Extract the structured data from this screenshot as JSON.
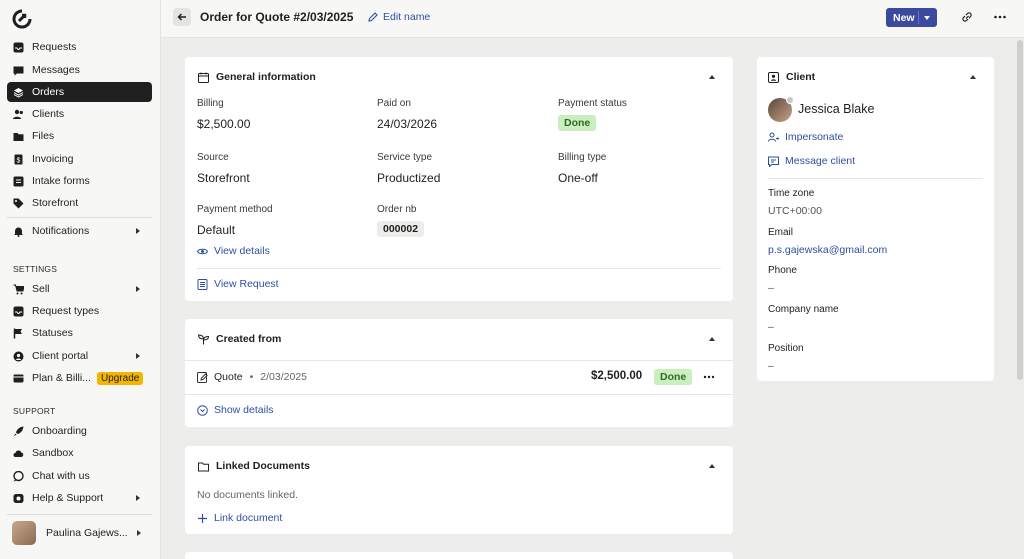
{
  "sidebar": {
    "nav": [
      {
        "label": "Requests",
        "icon": "inbox-icon"
      },
      {
        "label": "Messages",
        "icon": "chat-icon"
      },
      {
        "label": "Orders",
        "icon": "layers-icon",
        "active": true
      },
      {
        "label": "Clients",
        "icon": "users-icon"
      },
      {
        "label": "Files",
        "icon": "folder-icon"
      },
      {
        "label": "Invoicing",
        "icon": "invoice-icon"
      },
      {
        "label": "Intake forms",
        "icon": "form-icon"
      },
      {
        "label": "Storefront",
        "icon": "tag-icon"
      }
    ],
    "notifications": "Notifications",
    "settings_title": "SETTINGS",
    "settings": [
      {
        "label": "Sell",
        "icon": "cart-icon",
        "has_submenu": true
      },
      {
        "label": "Request types",
        "icon": "inbox-icon"
      },
      {
        "label": "Statuses",
        "icon": "flag-icon"
      },
      {
        "label": "Client portal",
        "icon": "globe-icon",
        "has_submenu": true
      },
      {
        "label": "Plan & Billi...",
        "icon": "card-icon",
        "badge": "Upgrade"
      }
    ],
    "support_title": "SUPPORT",
    "support": [
      {
        "label": "Onboarding",
        "icon": "rocket-icon"
      },
      {
        "label": "Sandbox",
        "icon": "cloud-icon"
      },
      {
        "label": "Chat with us",
        "icon": "chat-bubble-icon"
      },
      {
        "label": "Help & Support",
        "icon": "help-icon",
        "has_submenu": true
      }
    ],
    "user_name": "Paulina Gajews..."
  },
  "header": {
    "title": "Order for Quote #2/03/2025",
    "edit_name": "Edit name",
    "new_button": "New"
  },
  "general": {
    "title": "General information",
    "billing_label": "Billing",
    "billing_value": "$2,500.00",
    "paid_on_label": "Paid on",
    "paid_on_value": "24/03/2026",
    "payment_status_label": "Payment status",
    "payment_status_value": "Done",
    "source_label": "Source",
    "source_value": "Storefront",
    "service_type_label": "Service type",
    "service_type_value": "Productized",
    "billing_type_label": "Billing type",
    "billing_type_value": "One-off",
    "payment_method_label": "Payment method",
    "payment_method_value": "Default",
    "order_nb_label": "Order nb",
    "order_nb_value": "000002",
    "view_details": "View details",
    "view_request": "View Request"
  },
  "created_from": {
    "title": "Created from",
    "item_type": "Quote",
    "item_sep": "•",
    "item_date": "2/03/2025",
    "item_amount": "$2,500.00",
    "item_status": "Done",
    "show_details": "Show details"
  },
  "linked_docs": {
    "title": "Linked Documents",
    "empty": "No documents linked.",
    "link_document": "Link document"
  },
  "client": {
    "title": "Client",
    "name": "Jessica Blake",
    "impersonate": "Impersonate",
    "message": "Message client",
    "timezone_label": "Time zone",
    "timezone_value": "UTC+00:00",
    "email_label": "Email",
    "email_value": "p.s.gajewska@gmail.com",
    "phone_label": "Phone",
    "phone_value": "–",
    "company_label": "Company name",
    "company_value": "–",
    "position_label": "Position",
    "position_value": "–"
  },
  "colors": {
    "accent": "#3c4a9e",
    "link": "#2f4f9e",
    "done_bg": "#c9efc0",
    "upgrade": "#f2b600"
  }
}
